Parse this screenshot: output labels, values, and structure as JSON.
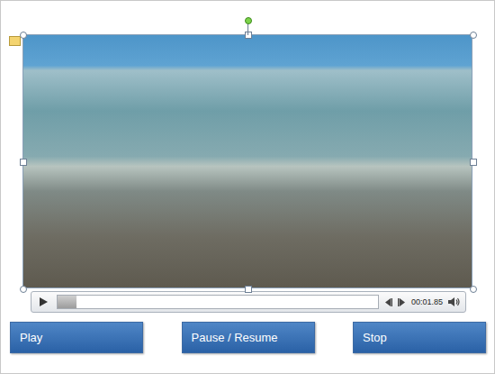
{
  "slide": {
    "video": {
      "selected": true
    },
    "player": {
      "playing": false,
      "level": 0.06,
      "time": "00:01.85"
    }
  },
  "buttons": [
    {
      "label": "Play"
    },
    {
      "label": "Pause / Resume"
    },
    {
      "label": "Stop"
    }
  ]
}
